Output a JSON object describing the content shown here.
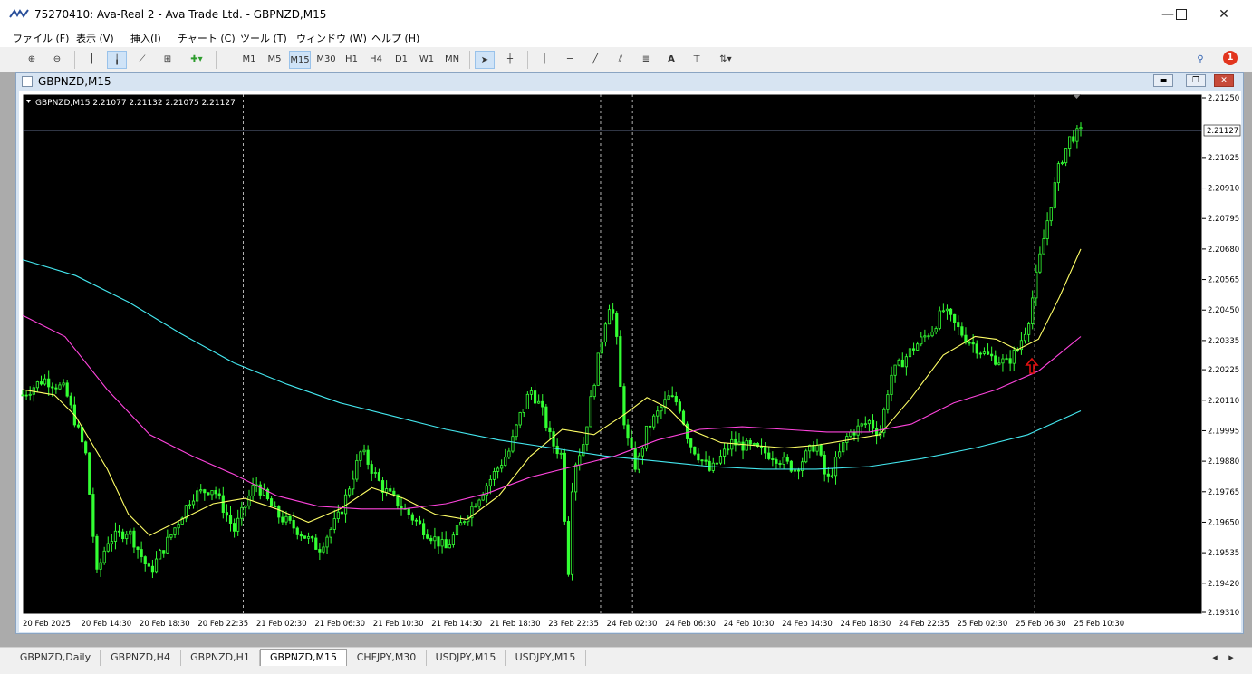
{
  "window": {
    "title": "75270410: Ava-Real 2 - Ava Trade Ltd. - GBPNZD,M15"
  },
  "menu": [
    "ファイル (F)",
    "表示 (V)",
    "挿入(I)",
    "チャート (C)",
    "ツール (T)",
    "ウィンドウ (W)",
    "ヘルプ (H)"
  ],
  "toolbar": {
    "timeframes": [
      "M1",
      "M5",
      "M15",
      "M30",
      "H1",
      "H4",
      "D1",
      "W1",
      "MN"
    ],
    "active_timeframe": "M15",
    "draw_text_tool": "A",
    "notification_count": "1"
  },
  "chart_window": {
    "title": "GBPNZD,M15"
  },
  "chart_data": {
    "type": "candlestick",
    "symbol_info": "GBPNZD,M15  2.21077 2.21132 2.21075 2.21127",
    "current_price": "2.21127",
    "y_ticks": [
      "2.21250",
      "2.21025",
      "2.20910",
      "2.20795",
      "2.20680",
      "2.20565",
      "2.20450",
      "2.20335",
      "2.20225",
      "2.20110",
      "2.19995",
      "2.19880",
      "2.19765",
      "2.19650",
      "2.19535",
      "2.19420",
      "2.19310"
    ],
    "y_tick_values": [
      2.2125,
      2.21025,
      2.2091,
      2.20795,
      2.2068,
      2.20565,
      2.2045,
      2.20335,
      2.20225,
      2.2011,
      2.19995,
      2.1988,
      2.19765,
      2.1965,
      2.19535,
      2.1942,
      2.1931
    ],
    "ylim": [
      2.1931,
      2.2125
    ],
    "x_ticks": [
      "20 Feb 2025",
      "20 Feb 14:30",
      "20 Feb 18:30",
      "20 Feb 22:35",
      "21 Feb 02:30",
      "21 Feb 06:30",
      "21 Feb 10:30",
      "21 Feb 14:30",
      "21 Feb 18:30",
      "23 Feb 22:35",
      "24 Feb 02:30",
      "24 Feb 06:30",
      "24 Feb 10:30",
      "24 Feb 14:30",
      "24 Feb 18:30",
      "24 Feb 22:35",
      "25 Feb 02:30",
      "25 Feb 06:30",
      "25 Feb 10:30"
    ],
    "close_path": [
      [
        0,
        2.2013
      ],
      [
        0.02,
        2.2019
      ],
      [
        0.04,
        2.2015
      ],
      [
        0.06,
        2.199
      ],
      [
        0.07,
        2.1945
      ],
      [
        0.08,
        2.1958
      ],
      [
        0.1,
        2.1962
      ],
      [
        0.12,
        2.1946
      ],
      [
        0.14,
        2.196
      ],
      [
        0.16,
        2.1975
      ],
      [
        0.18,
        2.1978
      ],
      [
        0.2,
        2.1962
      ],
      [
        0.22,
        2.198
      ],
      [
        0.24,
        2.1968
      ],
      [
        0.26,
        2.1962
      ],
      [
        0.28,
        2.1955
      ],
      [
        0.3,
        2.1968
      ],
      [
        0.32,
        2.1992
      ],
      [
        0.34,
        2.1978
      ],
      [
        0.36,
        2.197
      ],
      [
        0.38,
        2.1962
      ],
      [
        0.4,
        2.1955
      ],
      [
        0.42,
        2.1968
      ],
      [
        0.44,
        2.198
      ],
      [
        0.46,
        2.1992
      ],
      [
        0.47,
        2.2005
      ],
      [
        0.48,
        2.2015
      ],
      [
        0.49,
        2.2008
      ],
      [
        0.5,
        2.1995
      ],
      [
        0.51,
        2.199
      ],
      [
        0.515,
        2.194
      ],
      [
        0.52,
        2.1985
      ],
      [
        0.53,
        2.1995
      ],
      [
        0.54,
        2.2018
      ],
      [
        0.55,
        2.204
      ],
      [
        0.555,
        2.2048
      ],
      [
        0.56,
        2.204
      ],
      [
        0.565,
        2.2015
      ],
      [
        0.57,
        2.1998
      ],
      [
        0.58,
        2.1985
      ],
      [
        0.59,
        2.2
      ],
      [
        0.61,
        2.2012
      ],
      [
        0.62,
        2.201
      ],
      [
        0.63,
        2.1995
      ],
      [
        0.65,
        2.1984
      ],
      [
        0.67,
        2.1995
      ],
      [
        0.69,
        2.1993
      ],
      [
        0.71,
        2.199
      ],
      [
        0.73,
        2.1985
      ],
      [
        0.75,
        2.1995
      ],
      [
        0.76,
        2.198
      ],
      [
        0.78,
        2.1998
      ],
      [
        0.8,
        2.2003
      ],
      [
        0.81,
        2.1998
      ],
      [
        0.82,
        2.202
      ],
      [
        0.84,
        2.203
      ],
      [
        0.86,
        2.2038
      ],
      [
        0.87,
        2.2045
      ],
      [
        0.88,
        2.204
      ],
      [
        0.89,
        2.2035
      ],
      [
        0.91,
        2.2028
      ],
      [
        0.93,
        2.2025
      ],
      [
        0.94,
        2.203
      ],
      [
        0.95,
        2.204
      ],
      [
        0.96,
        2.2062
      ],
      [
        0.97,
        2.2082
      ],
      [
        0.98,
        2.21
      ],
      [
        0.99,
        2.211
      ],
      [
        1.0,
        2.2112
      ]
    ],
    "ma_series": [
      {
        "color": "#ffff66",
        "points": [
          [
            0,
            2.2015
          ],
          [
            0.03,
            2.2013
          ],
          [
            0.05,
            2.2005
          ],
          [
            0.08,
            2.1985
          ],
          [
            0.1,
            2.1968
          ],
          [
            0.12,
            2.196
          ],
          [
            0.15,
            2.1966
          ],
          [
            0.18,
            2.1972
          ],
          [
            0.21,
            2.1974
          ],
          [
            0.24,
            2.197
          ],
          [
            0.27,
            2.1965
          ],
          [
            0.3,
            2.197
          ],
          [
            0.33,
            2.1978
          ],
          [
            0.36,
            2.1974
          ],
          [
            0.39,
            2.1968
          ],
          [
            0.42,
            2.1966
          ],
          [
            0.45,
            2.1975
          ],
          [
            0.48,
            2.199
          ],
          [
            0.51,
            2.2
          ],
          [
            0.54,
            2.1998
          ],
          [
            0.57,
            2.2006
          ],
          [
            0.59,
            2.2012
          ],
          [
            0.61,
            2.2008
          ],
          [
            0.63,
            2.2
          ],
          [
            0.66,
            2.1995
          ],
          [
            0.69,
            2.1994
          ],
          [
            0.72,
            2.1993
          ],
          [
            0.75,
            2.1994
          ],
          [
            0.78,
            2.1996
          ],
          [
            0.81,
            2.1998
          ],
          [
            0.84,
            2.2012
          ],
          [
            0.87,
            2.2028
          ],
          [
            0.9,
            2.2035
          ],
          [
            0.92,
            2.2034
          ],
          [
            0.94,
            2.203
          ],
          [
            0.96,
            2.2034
          ],
          [
            0.98,
            2.205
          ],
          [
            1.0,
            2.2068
          ]
        ]
      },
      {
        "color": "#ff44dd",
        "points": [
          [
            0,
            2.2043
          ],
          [
            0.04,
            2.2035
          ],
          [
            0.08,
            2.2015
          ],
          [
            0.12,
            2.1998
          ],
          [
            0.16,
            2.199
          ],
          [
            0.2,
            2.1983
          ],
          [
            0.24,
            2.1975
          ],
          [
            0.28,
            2.1971
          ],
          [
            0.32,
            2.197
          ],
          [
            0.36,
            2.197
          ],
          [
            0.4,
            2.1972
          ],
          [
            0.44,
            2.1976
          ],
          [
            0.48,
            2.1982
          ],
          [
            0.52,
            2.1986
          ],
          [
            0.56,
            2.199
          ],
          [
            0.6,
            2.1996
          ],
          [
            0.64,
            2.2
          ],
          [
            0.68,
            2.2001
          ],
          [
            0.72,
            2.2
          ],
          [
            0.76,
            2.1999
          ],
          [
            0.8,
            2.1999
          ],
          [
            0.84,
            2.2002
          ],
          [
            0.88,
            2.201
          ],
          [
            0.92,
            2.2015
          ],
          [
            0.96,
            2.2022
          ],
          [
            1.0,
            2.2035
          ]
        ]
      },
      {
        "color": "#44e8f0",
        "points": [
          [
            0,
            2.2064
          ],
          [
            0.05,
            2.2058
          ],
          [
            0.1,
            2.2048
          ],
          [
            0.15,
            2.2036
          ],
          [
            0.2,
            2.2025
          ],
          [
            0.25,
            2.2017
          ],
          [
            0.3,
            2.201
          ],
          [
            0.35,
            2.2005
          ],
          [
            0.4,
            2.2
          ],
          [
            0.45,
            2.1996
          ],
          [
            0.5,
            2.1993
          ],
          [
            0.55,
            2.199
          ],
          [
            0.6,
            2.1988
          ],
          [
            0.65,
            2.1986
          ],
          [
            0.7,
            2.1985
          ],
          [
            0.75,
            2.1985
          ],
          [
            0.8,
            2.1986
          ],
          [
            0.85,
            2.1989
          ],
          [
            0.9,
            2.1993
          ],
          [
            0.95,
            2.1998
          ],
          [
            1.0,
            2.2007
          ]
        ]
      }
    ]
  },
  "tabs": [
    "GBPNZD,Daily",
    "GBPNZD,H4",
    "GBPNZD,H1",
    "GBPNZD,M15",
    "CHFJPY,M30",
    "USDJPY,M15",
    "USDJPY,M15"
  ],
  "active_tab": "GBPNZD,M15"
}
